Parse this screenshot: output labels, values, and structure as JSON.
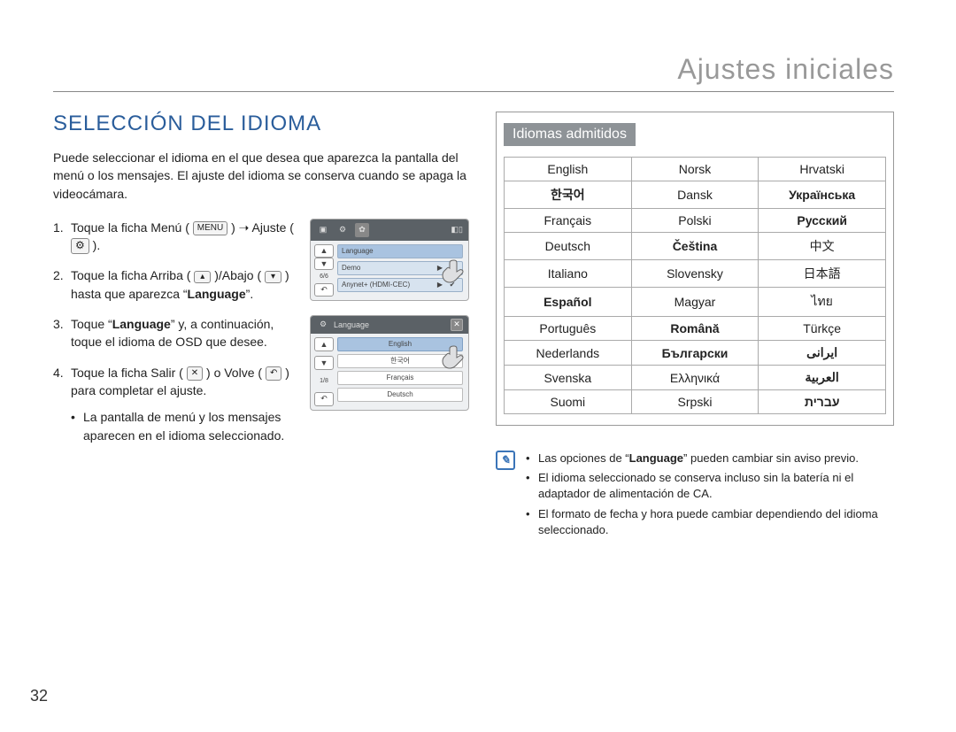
{
  "header": {
    "title": "Ajustes iniciales"
  },
  "section": {
    "title": "SELECCIÓN DEL IDIOMA"
  },
  "intro": "Puede seleccionar el idioma en el que desea que aparezca la pantalla del menú o los mensajes. El ajuste del idioma se conserva cuando se apaga la videocámara.",
  "steps": {
    "s1": {
      "num": "1.",
      "pre": "Toque la ficha Menú (",
      "menu_key": "MENU",
      "mid": ") ➝ Ajuste (",
      "post": ")."
    },
    "s2": {
      "num": "2.",
      "pre": "Toque la ficha Arriba (",
      "mid": ")/Abajo (",
      "post": ") hasta que aparezca “",
      "bold": "Language",
      "end": "”."
    },
    "s3": {
      "num": "3.",
      "pre": "Toque “",
      "bold": "Language",
      "post": "” y, a continuación, toque el idioma de OSD que desee."
    },
    "s4": {
      "num": "4.",
      "pre": "Toque la ficha Salir (",
      "mid": ") o Volve (",
      "post": ") para completar el ajuste.",
      "bullet1": "La pantalla de menú y los mensajes aparecen en el idioma seleccionado."
    }
  },
  "screenshots": {
    "a": {
      "battery": "◧▯",
      "row1": "Language",
      "row2": "Demo",
      "row3": "Anynet+ (HDMI-CEC)",
      "side_page": "6/6",
      "side_up": "▲",
      "side_down": "▼",
      "side_back": "↶",
      "row2_right": "▶",
      "row3_right": "✔",
      "top_gear": "⚙",
      "top_cam": "▣",
      "top_set": "✿",
      "row3_icon": "⌂"
    },
    "b": {
      "title_icon": "⚙",
      "title": "Language",
      "close": "✕",
      "row1": "English",
      "row2": "한국어",
      "row3": "Français",
      "row4": "Deutsch",
      "side_page": "1/8",
      "side_up": "▲",
      "side_down": "▼",
      "side_back": "↶"
    }
  },
  "supported": {
    "badge": "Idiomas admitidos",
    "rows": [
      [
        "English",
        "Norsk",
        "Hrvatski"
      ],
      [
        "한국어",
        "Dansk",
        "Українська"
      ],
      [
        "Français",
        "Polski",
        "Русский"
      ],
      [
        "Deutsch",
        "Čeština",
        "中文"
      ],
      [
        "Italiano",
        "Slovensky",
        "日本語"
      ],
      [
        "Español",
        "Magyar",
        "ไทย"
      ],
      [
        "Português",
        "Română",
        "Türkçe"
      ],
      [
        "Nederlands",
        "Български",
        "ایرانی"
      ],
      [
        "Svenska",
        "Ελληνικά",
        "العربية"
      ],
      [
        "Suomi",
        "Srpski",
        "עברית"
      ]
    ],
    "bold_map": [
      [
        false,
        false,
        false
      ],
      [
        true,
        false,
        true
      ],
      [
        false,
        false,
        true
      ],
      [
        false,
        true,
        false
      ],
      [
        false,
        false,
        false
      ],
      [
        true,
        false,
        false
      ],
      [
        false,
        true,
        false
      ],
      [
        false,
        true,
        true
      ],
      [
        false,
        false,
        true
      ],
      [
        false,
        false,
        true
      ]
    ]
  },
  "notes": {
    "n1_pre": "Las opciones de “",
    "n1_bold": "Language",
    "n1_post": "” pueden cambiar sin aviso previo.",
    "n2": "El idioma seleccionado se conserva incluso sin la batería ni el adaptador de alimentación de CA.",
    "n3": "El formato de fecha y hora puede cambiar dependiendo del idioma seleccionado."
  },
  "page_number": "32",
  "glyphs": {
    "x": "✕",
    "back": "↶",
    "up": "▴",
    "down": "▾"
  }
}
